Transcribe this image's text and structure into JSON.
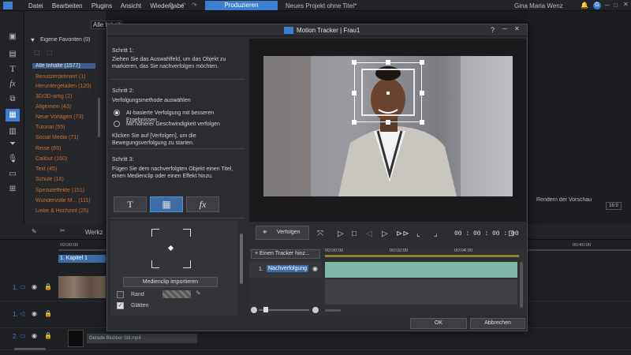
{
  "app": {
    "menu": [
      "Datei",
      "Bearbeiten",
      "Plugins",
      "Ansicht",
      "Wiedergabe"
    ],
    "produce_label": "Produzieren",
    "project_title": "Neues Projekt ohne Titel*",
    "user_name": "Gina Maria Wenz",
    "user_initial": "G"
  },
  "library": {
    "filter": "Alle Inhalte",
    "favorites": "Eigene Favoriten (0)",
    "items": [
      {
        "label": "Alle Inhalte (1577)",
        "selected": true
      },
      {
        "label": "Benutzerdefiniert (1)"
      },
      {
        "label": "Heruntergeladen (120)"
      },
      {
        "label": "3D/3D-artig (2)"
      },
      {
        "label": "Allgemein (43)"
      },
      {
        "label": "Neue Vorlagen (73)"
      },
      {
        "label": "Tutorial (55)"
      },
      {
        "label": "Social Media (71)"
      },
      {
        "label": "Reise (65)"
      },
      {
        "label": "Callout (160)"
      },
      {
        "label": "Text (45)"
      },
      {
        "label": "Schule (16)"
      },
      {
        "label": "Spezialeffekte (151)"
      },
      {
        "label": "Wundervolle M... (111)"
      },
      {
        "label": "Liebe & Hochzeit (25)"
      }
    ]
  },
  "preview_panel": {
    "render_label": "Rendern der Vorschau",
    "ratio": "16:9"
  },
  "timeline": {
    "toolbar_label": "Werkz",
    "time_start": "00:00:00",
    "time_end": "00:40:00",
    "chapter": "1. Kapitel 1",
    "tracks": [
      "1.",
      "1.",
      "2."
    ],
    "clip_label": "Gerade Blubber Stil.mp4"
  },
  "dialog": {
    "title": "Motion Tracker  |  Frau1",
    "help": "?",
    "steps": {
      "step1_title": "Schritt 1:",
      "step1_text": "Ziehen Sie das Auswahlfeld, um das Objekt zu markieren, das Sie nachverfolgen möchten.",
      "step2_title": "Schritt 2:",
      "step2_text": "Verfolgungsmethode auswählen",
      "option_ai": "AI-basierte Verfolgung mit besseren Ergebnissen",
      "option_fast": "Mit höherer Geschwindigkeit verfolgen",
      "step2_hint": "Klicken Sie auf [Verfolgen], um die Bewegungsverfolgung zu starten.",
      "step3_title": "Schritt 3:",
      "step3_text": "Fügen Sie dem nachverfolgten Objekt einen Titel, einen Medienclip oder einen Effekt hinzu."
    },
    "object_buttons": {
      "title": "T",
      "media": "▦",
      "effect": "fx"
    },
    "import_button": "Medienclip importieren",
    "checkbox_border": "Rand",
    "checkbox_smooth": "Glätten",
    "track_button": "Verfolgen",
    "timecode": "00 : 00 : 00 : 00",
    "add_tracker": "Einen Tracker hinz...",
    "tracker_times": [
      "00:00:00",
      "00:02:00",
      "00:04:00"
    ],
    "tracker_item_index": "1.",
    "tracker_item_label": "Nachverfolgung",
    "ok": "OK",
    "cancel": "Abbrechen"
  },
  "colors": {
    "accent": "#3c7fd2",
    "tracker_fill": "#7fb8a8",
    "orange_text": "#c96d2f"
  }
}
